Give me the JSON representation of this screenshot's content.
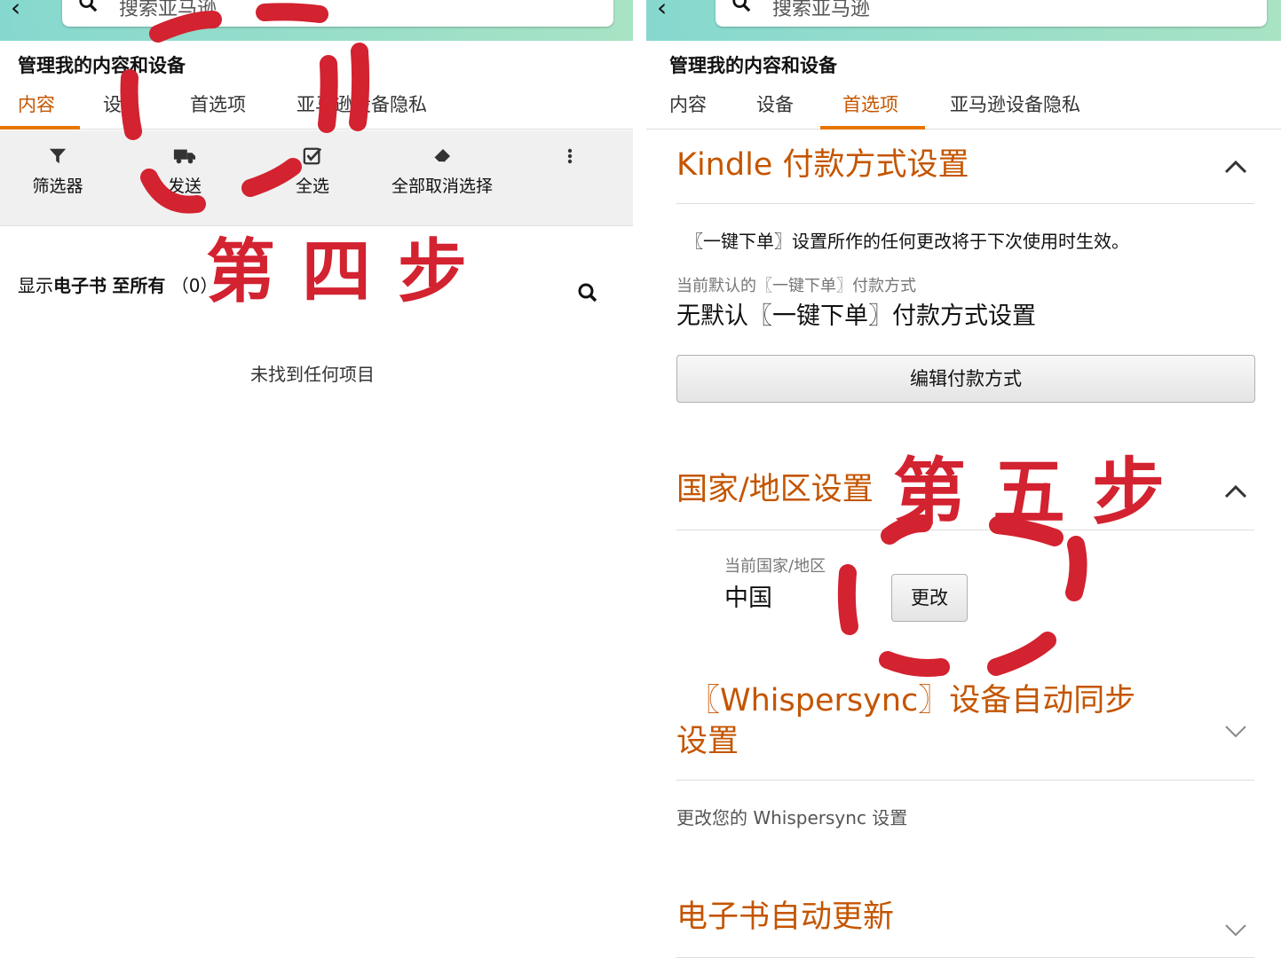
{
  "search_placeholder": "搜索亚马逊",
  "page_title": "管理我的内容和设备",
  "tabs": [
    "内容",
    "设备",
    "首选项",
    "亚马逊设备隐私"
  ],
  "left_tabs_visible": [
    "内容",
    "设",
    "首选项",
    "亚马逊设备隐私"
  ],
  "toolbar": {
    "filter": "筛选器",
    "send": "发送",
    "select_all": "全选",
    "deselect_all": "全部取消选择"
  },
  "listing": {
    "prefix": "显示",
    "type": "电子书",
    "scope": "至所有",
    "count": "（0）"
  },
  "empty_text": "未找到任何项目",
  "payment": {
    "title": "Kindle 付款方式设置",
    "note": "〖一键下单〗设置所作的任何更改将于下次使用时生效。",
    "current_label": "当前默认的〖一键下单〗付款方式",
    "current_value": "无默认〖一键下单〗付款方式设置",
    "edit_button": "编辑付款方式"
  },
  "country": {
    "title": "国家/地区设置",
    "current_label": "当前国家/地区",
    "current_value": "中国",
    "change_button": "更改"
  },
  "whispersync": {
    "title_line1": "〖Whispersync〗设备自动同步",
    "title_line2": "设置",
    "desc": "更改您的 Whispersync 设置"
  },
  "auto_update": {
    "title": "电子书自动更新"
  },
  "annotations": {
    "step4": "第四步",
    "step5": "第五步"
  },
  "colors": {
    "accent": "#c45500",
    "tab_underline": "#e77600",
    "annotation": "#d32230",
    "topbar": "#86d8cf"
  }
}
